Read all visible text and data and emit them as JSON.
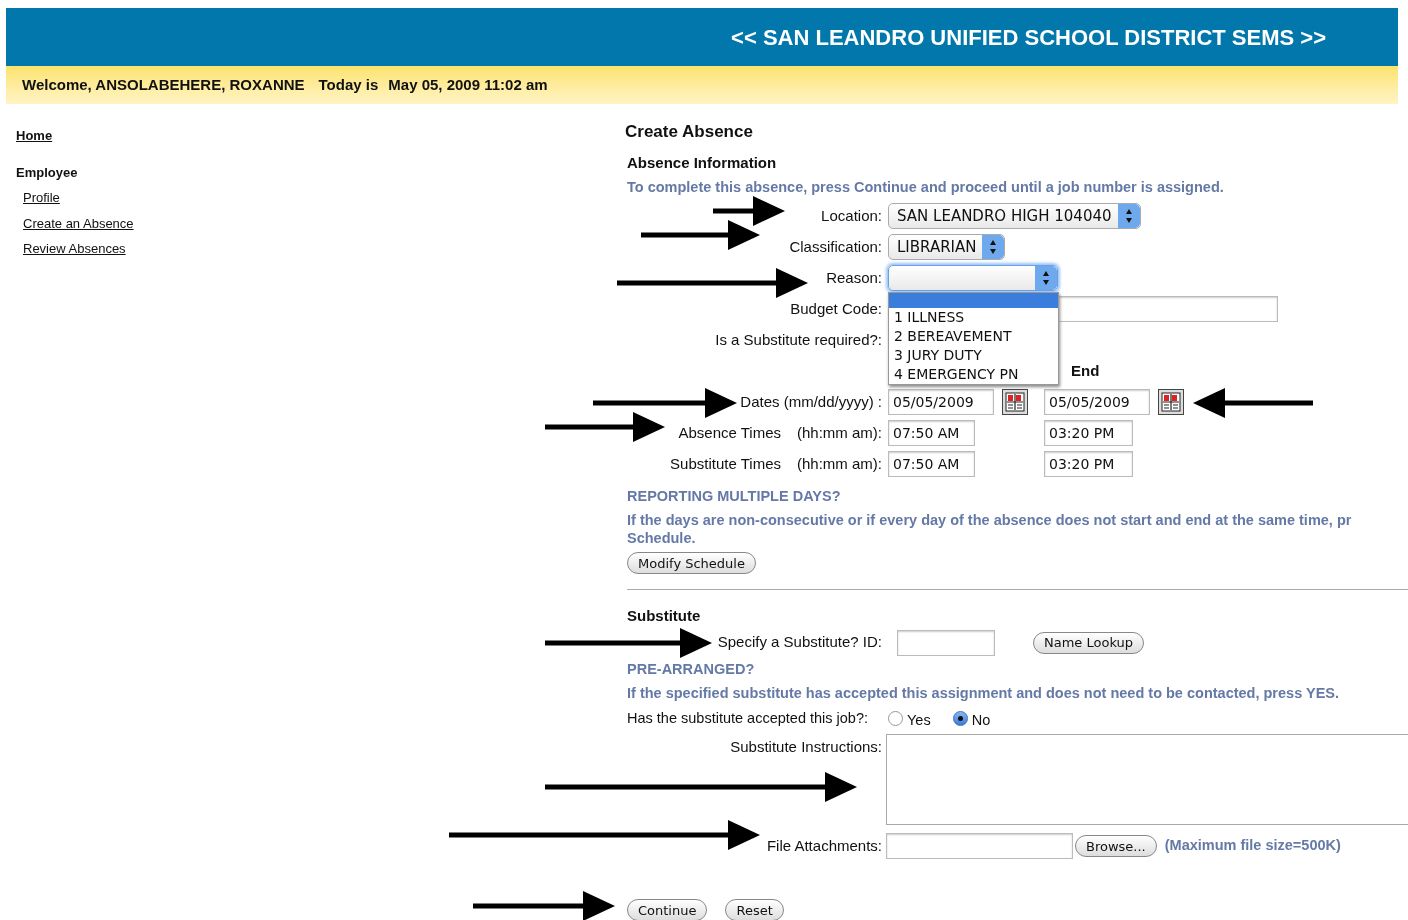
{
  "header": {
    "title": "<< SAN LEANDRO UNIFIED SCHOOL DISTRICT SEMS >>"
  },
  "welcome_bar": {
    "welcome": "Welcome, ANSOLABEHERE, ROXANNE",
    "today_label": "Today is",
    "date": "May 05, 2009 11:02 am"
  },
  "sidebar": {
    "home": "Home",
    "section": "Employee",
    "items": [
      "Profile",
      "Create an Absence",
      "Review Absences"
    ]
  },
  "page_title": "Create Absence",
  "absence_info": {
    "heading": "Absence Information",
    "instruction": "To complete this absence, press Continue and proceed until a job number is assigned.",
    "location": {
      "label": "Location:",
      "value": "SAN LEANDRO HIGH 104040"
    },
    "classification": {
      "label": "Classification:",
      "value": "LIBRARIAN"
    },
    "reason": {
      "label": "Reason:",
      "open": true,
      "options": [
        "1 ILLNESS",
        "2 BEREAVEMENT",
        "3 JURY DUTY",
        "4 EMERGENCY PN"
      ]
    },
    "budget_code": {
      "label": "Budget Code:"
    },
    "substitute_required": {
      "label": "Is a Substitute required?:"
    },
    "end_header": "End",
    "dates": {
      "label": "Dates (mm/dd/yyyy) :",
      "start": "05/05/2009",
      "end": "05/05/2009"
    },
    "time_rows": [
      {
        "label": "Absence Times",
        "format": "(hh:mm am):",
        "start": "07:50 AM",
        "end": "03:20 PM"
      },
      {
        "label": "Substitute Times",
        "format": "(hh:mm am):",
        "start": "07:50 AM",
        "end": "03:20 PM"
      }
    ]
  },
  "multiple_days": {
    "heading": "REPORTING MULTIPLE DAYS?",
    "text_line_1": "If the days are non-consecutive or if every day of the absence does not start and end at the same time, pr",
    "text_line_2": "Schedule.",
    "button": "Modify Schedule"
  },
  "substitute": {
    "heading": "Substitute",
    "id_label": "Specify a Substitute? ID:",
    "lookup_button": "Name Lookup",
    "pre_arranged": "PRE-ARRANGED?",
    "pre_arranged_text": "If the specified substitute has accepted this assignment and does not need to be contacted, press YES.",
    "accepted_label": "Has the substitute accepted this job?:",
    "accepted_options": [
      {
        "label": "Yes",
        "selected": false
      },
      {
        "label": "No",
        "selected": true
      }
    ],
    "instructions_label": "Substitute Instructions:",
    "attachments_label": "File Attachments:",
    "browse_button": "Browse...",
    "max_size": "(Maximum file size=500K)"
  },
  "actions": [
    "Continue",
    "Reset"
  ]
}
